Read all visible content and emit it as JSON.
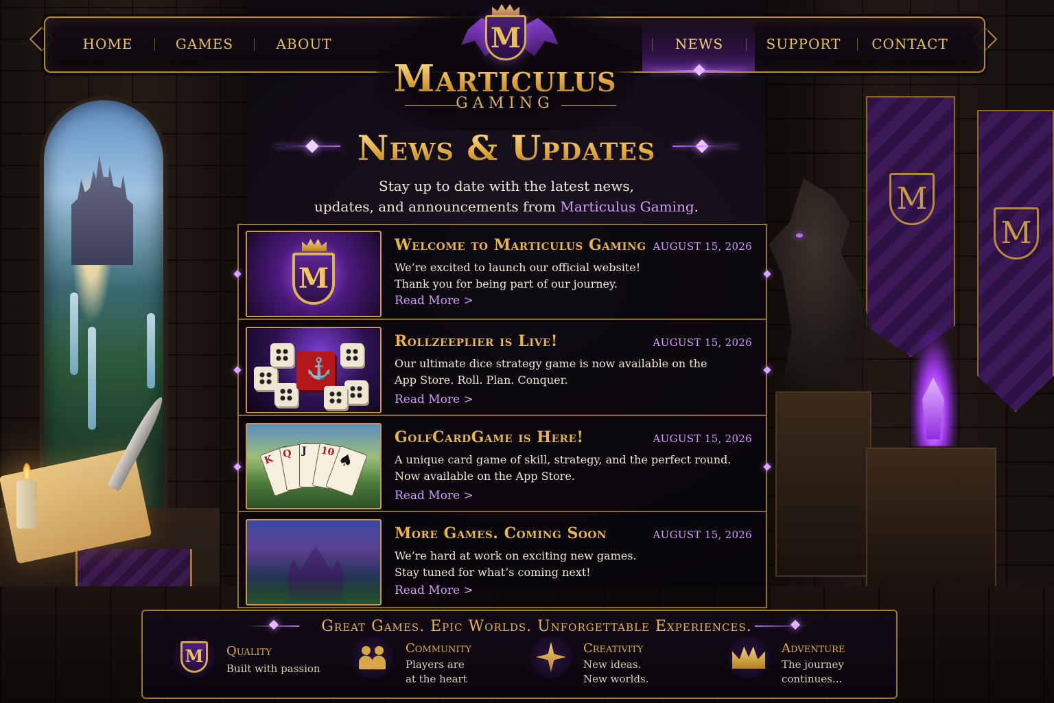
{
  "brand": {
    "logo_letter": "M",
    "name": "Marticulus",
    "subtitle": "GAMING"
  },
  "nav": {
    "items": [
      {
        "label": "HOME"
      },
      {
        "label": "GAMES"
      },
      {
        "label": "ABOUT"
      },
      {
        "label": "NEWS",
        "active": true
      },
      {
        "label": "SUPPORT"
      },
      {
        "label": "CONTACT"
      }
    ]
  },
  "page": {
    "title": "News & Updates",
    "intro_line1": "Stay up to date with the latest news,",
    "intro_line2_prefix": "updates, and announcements from ",
    "intro_highlight": "Marticulus Gaming",
    "intro_suffix": "."
  },
  "news": [
    {
      "title": "Welcome to Marticulus Gaming",
      "date": "AUGUST 15, 2026",
      "lines": [
        "We’re excited to launch our official website!",
        "Thank you for being part of our journey."
      ],
      "read_more": "Read More  >",
      "thumb": "logo-shield-thumbnail"
    },
    {
      "title": "Rollzeeplier is Live!",
      "date": "AUGUST 15, 2026",
      "lines": [
        "Our ultimate dice strategy game is now available on the",
        "App Store. Roll. Plan. Conquer."
      ],
      "read_more": "Read More  >",
      "thumb": "dice-thumbnail"
    },
    {
      "title": "GolfCardGame is Here!",
      "date": "AUGUST 15, 2026",
      "lines": [
        "A unique card game of skill, strategy, and the perfect round.",
        "Now available on the App Store."
      ],
      "read_more": "Read More  >",
      "thumb": "cards-thumbnail"
    },
    {
      "title": "More Games. Coming Soon",
      "date": "AUGUST 15, 2026",
      "lines": [
        "We’re hard at work on exciting new games.",
        "Stay tuned for what’s coming next!"
      ],
      "read_more": "Read More  >",
      "thumb": "castle-thumbnail"
    }
  ],
  "footer": {
    "tagline": "Great Games. Epic Worlds. Unforgettable Experiences.",
    "features": [
      {
        "icon": "m-shield-icon",
        "title": "Quality",
        "desc1": "Built with passion",
        "desc2": ""
      },
      {
        "icon": "community-icon",
        "title": "Community",
        "desc1": "Players are",
        "desc2": "at the heart"
      },
      {
        "icon": "compass-star-icon",
        "title": "Creativity",
        "desc1": "New ideas.",
        "desc2": "New worlds."
      },
      {
        "icon": "crown-icon",
        "title": "Adventure",
        "desc1": "The journey",
        "desc2": "continues..."
      }
    ]
  },
  "colors": {
    "gold": "#e8b547",
    "purple_accent": "#d59cff",
    "background": "#0e0a10"
  }
}
